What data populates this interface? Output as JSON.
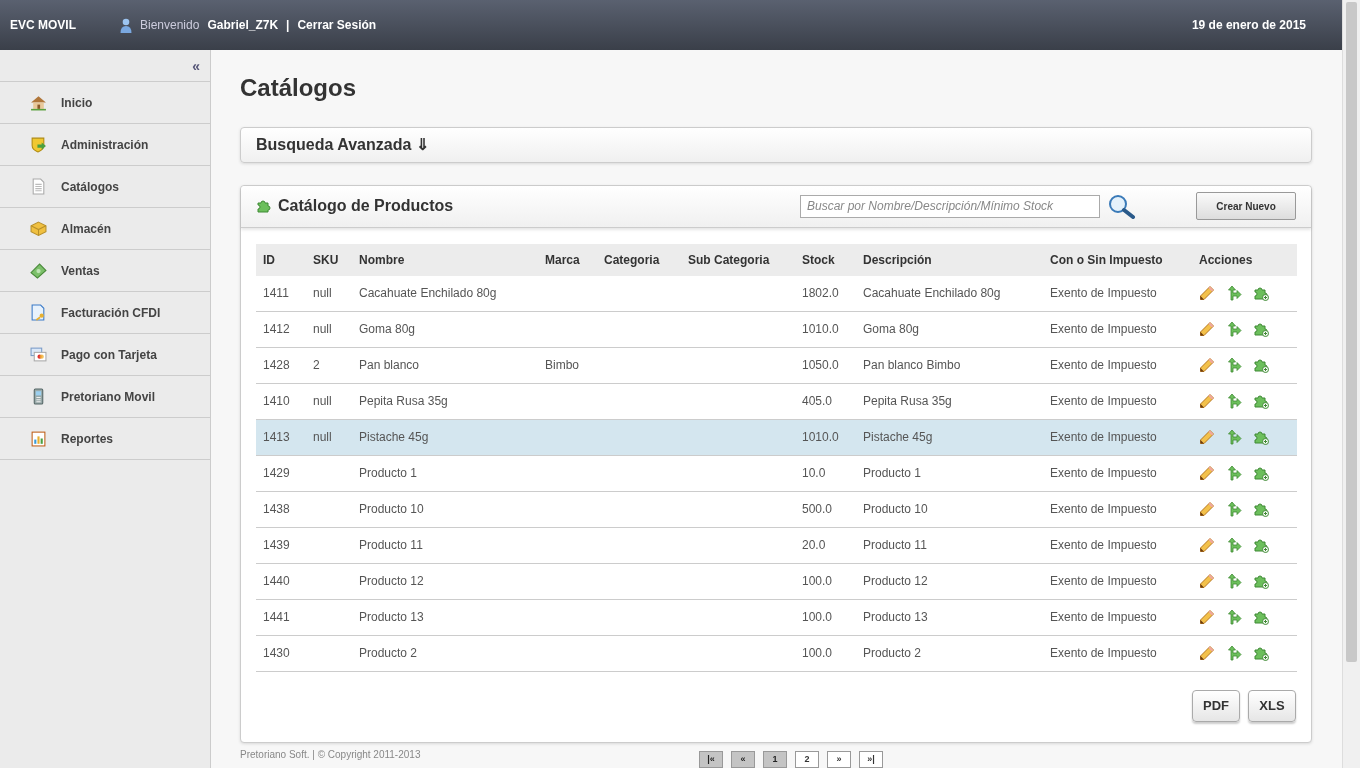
{
  "header": {
    "brand": "EVC MOVIL",
    "welcome": "Bienvenido",
    "user": "Gabriel_Z7K",
    "separator": "|",
    "logout": "Cerrar Sesión",
    "date": "19 de enero de 2015"
  },
  "sidebar": {
    "collapse": "«",
    "items": [
      {
        "label": "Inicio",
        "kind": "home",
        "selected": false
      },
      {
        "label": "Administración",
        "kind": "admin",
        "selected": false
      },
      {
        "label": "Catálogos",
        "kind": "doc",
        "selected": false
      },
      {
        "label": "Almacén",
        "kind": "box",
        "selected": false
      },
      {
        "label": "Ventas",
        "kind": "money",
        "selected": false
      },
      {
        "label": "Facturación CFDI",
        "kind": "invoice",
        "selected": false
      },
      {
        "label": "Pago con Tarjeta",
        "kind": "card",
        "selected": false
      },
      {
        "label": "Pretoriano Movil",
        "kind": "phone",
        "selected": false
      },
      {
        "label": "Reportes",
        "kind": "report",
        "selected": false
      }
    ]
  },
  "page_title": "Catálogos",
  "advanced_search": {
    "title": "Busqueda Avanzada ⇓"
  },
  "catalog": {
    "title": "Catálogo de Productos",
    "search": {
      "placeholder": "Buscar por Nombre/Descripción/Mínimo Stock"
    },
    "create_button": "Crear Nuevo",
    "table": {
      "columns": [
        "ID",
        "SKU",
        "Nombre",
        "Marca",
        "Categoria",
        "Sub Categoria",
        "Stock",
        "Descripción",
        "Con o Sin Impuesto",
        "Acciones"
      ],
      "rows": [
        {
          "cells": [
            "1411",
            "null",
            "Cacahuate Enchilado 80g",
            "",
            "",
            "",
            "1802.0",
            "Cacahuate Enchilado 80g",
            "Exento de Impuesto"
          ],
          "selected": false
        },
        {
          "cells": [
            "1412",
            "null",
            "Goma 80g",
            "",
            "",
            "",
            "1010.0",
            "Goma 80g",
            "Exento de Impuesto"
          ],
          "selected": false
        },
        {
          "cells": [
            "1428",
            "2",
            "Pan blanco",
            "Bimbo",
            "",
            "",
            "1050.0",
            "Pan blanco Bimbo",
            "Exento de Impuesto"
          ],
          "selected": false
        },
        {
          "cells": [
            "1410",
            "null",
            "Pepita Rusa 35g",
            "",
            "",
            "",
            "405.0",
            "Pepita Rusa 35g",
            "Exento de Impuesto"
          ],
          "selected": false
        },
        {
          "cells": [
            "1413",
            "null",
            "Pistache 45g",
            "",
            "",
            "",
            "1010.0",
            "Pistache 45g",
            "Exento de Impuesto"
          ],
          "selected": true
        },
        {
          "cells": [
            "1429",
            "",
            "Producto 1",
            "",
            "",
            "",
            "10.0",
            "Producto 1",
            "Exento de Impuesto"
          ],
          "selected": false
        },
        {
          "cells": [
            "1438",
            "",
            "Producto 10",
            "",
            "",
            "",
            "500.0",
            "Producto 10",
            "Exento de Impuesto"
          ],
          "selected": false
        },
        {
          "cells": [
            "1439",
            "",
            "Producto 11",
            "",
            "",
            "",
            "20.0",
            "Producto 11",
            "Exento de Impuesto"
          ],
          "selected": false
        },
        {
          "cells": [
            "1440",
            "",
            "Producto 12",
            "",
            "",
            "",
            "100.0",
            "Producto 12",
            "Exento de Impuesto"
          ],
          "selected": false
        },
        {
          "cells": [
            "1441",
            "",
            "Producto 13",
            "",
            "",
            "",
            "100.0",
            "Producto 13",
            "Exento de Impuesto"
          ],
          "selected": false
        },
        {
          "cells": [
            "1430",
            "",
            "Producto 2",
            "",
            "",
            "",
            "100.0",
            "Producto 2",
            "Exento de Impuesto"
          ],
          "selected": false
        }
      ]
    },
    "export_buttons": [
      "PDF",
      "XLS"
    ]
  },
  "footer": {
    "copyright": "Pretoriano Soft. | © Copyright 2011-2013"
  },
  "pagination": [
    {
      "label": "|«",
      "disabled": true
    },
    {
      "label": "«",
      "disabled": true
    },
    {
      "label": "1",
      "disabled": true
    },
    {
      "label": "2",
      "disabled": false
    },
    {
      "label": "»",
      "disabled": false
    },
    {
      "label": "»|",
      "disabled": false
    }
  ]
}
